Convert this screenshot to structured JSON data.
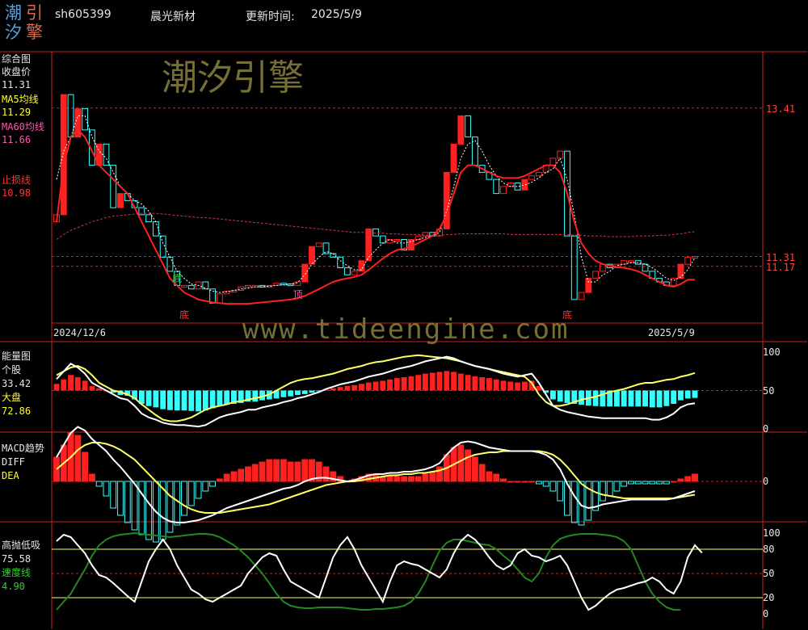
{
  "header": {
    "logo_chars": [
      "潮",
      "引",
      "汐",
      "擎"
    ],
    "code": "sh605399",
    "name": "晨光新材",
    "update_label": "更新时间:",
    "update_date": "2025/5/9"
  },
  "watermarks": {
    "brand": "潮汐引擎",
    "url": "www.tideengine.com"
  },
  "colors": {
    "frame": "#cc2222",
    "up": "#ff2020",
    "down": "#33ffff",
    "ma5": "#ffffff",
    "ma60": "#cc3355",
    "energy_market": "#ffff66",
    "energy_stock": "#ffffff",
    "speed": "#228822"
  },
  "panels": {
    "main": {
      "labels": [
        {
          "text": "综合图",
          "color": "w"
        },
        {
          "text": "收盘价",
          "color": "w"
        },
        {
          "text": "11.31",
          "color": "w"
        },
        {
          "text": "MA5均线",
          "color": "y"
        },
        {
          "text": "11.29",
          "color": "y"
        },
        {
          "text": "MA60均线",
          "color": "pk"
        },
        {
          "text": "11.66",
          "color": "pk"
        },
        {
          "text": "止损线",
          "color": "rd"
        },
        {
          "text": "10.98",
          "color": "rd"
        }
      ],
      "right_ticks": [
        "13.41",
        "11.31",
        "11.17"
      ],
      "markers": [
        {
          "text": "底",
          "color": "gr",
          "bar": 17
        },
        {
          "text": "底",
          "color": "rd",
          "bar": 18
        },
        {
          "text": "顶",
          "color": "pk",
          "bar": 34
        },
        {
          "text": "底",
          "color": "rd",
          "bar": 72
        }
      ],
      "start_date": "2024/12/6",
      "end_date": "2025/5/9"
    },
    "energy": {
      "labels": [
        {
          "text": "能量图",
          "color": "w"
        },
        {
          "text": "个股",
          "color": "w"
        },
        {
          "text": "33.42",
          "color": "w"
        },
        {
          "text": "大盘",
          "color": "y"
        },
        {
          "text": "72.86",
          "color": "y"
        }
      ],
      "right_ticks": [
        "100",
        "50",
        "0"
      ]
    },
    "macd": {
      "labels": [
        {
          "text": "MACD趋势",
          "color": "w"
        },
        {
          "text": "DIFF",
          "color": "w"
        },
        {
          "text": "DEA",
          "color": "y"
        }
      ],
      "right_ticks": [
        "0"
      ]
    },
    "tide": {
      "labels": [
        {
          "text": "高抛低吸",
          "color": "w"
        },
        {
          "text": "75.58",
          "color": "w"
        },
        {
          "text": "速度线",
          "color": "gr"
        },
        {
          "text": "4.90",
          "color": "gr"
        }
      ],
      "right_ticks": [
        "100",
        "80",
        "50",
        "20",
        "0"
      ]
    }
  },
  "chart_data": {
    "type": "candlestick",
    "price_axis_ticks": [
      13.41,
      11.31,
      11.17
    ],
    "close": [
      11.9,
      13.6,
      13.0,
      13.4,
      13.1,
      12.6,
      12.9,
      12.6,
      12.0,
      12.2,
      12.1,
      12.0,
      11.9,
      11.8,
      11.6,
      11.3,
      11.1,
      10.9,
      10.9,
      10.85,
      10.95,
      10.85,
      10.65,
      10.78,
      10.82,
      10.83,
      10.88,
      10.9,
      10.9,
      10.88,
      10.9,
      10.93,
      10.92,
      10.9,
      10.95,
      11.2,
      11.45,
      11.5,
      11.35,
      11.3,
      11.15,
      11.05,
      11.1,
      11.25,
      11.7,
      11.6,
      11.5,
      11.55,
      11.55,
      11.4,
      11.55,
      11.6,
      11.65,
      11.6,
      11.7,
      12.5,
      12.9,
      13.3,
      13.0,
      12.6,
      12.5,
      12.4,
      12.2,
      12.3,
      12.35,
      12.25,
      12.4,
      12.45,
      12.5,
      12.6,
      12.7,
      12.8,
      11.6,
      10.7,
      10.8,
      11.0,
      11.1,
      11.2,
      11.15,
      11.2,
      11.25,
      11.25,
      11.2,
      11.1,
      11.0,
      10.95,
      10.9,
      11.0,
      11.2,
      11.3,
      11.31
    ],
    "ma5": [
      12.4,
      12.8,
      13.0,
      13.3,
      13.3,
      13.0,
      12.8,
      12.7,
      12.5,
      12.3,
      12.2,
      12.1,
      12.05,
      11.95,
      11.8,
      11.5,
      11.3,
      11.1,
      11.0,
      10.92,
      10.9,
      10.86,
      10.82,
      10.8,
      10.81,
      10.83,
      10.85,
      10.86,
      10.88,
      10.88,
      10.89,
      10.9,
      10.91,
      10.92,
      10.94,
      11.05,
      11.2,
      11.3,
      11.38,
      11.35,
      11.25,
      11.18,
      11.12,
      11.12,
      11.3,
      11.4,
      11.5,
      11.55,
      11.5,
      11.5,
      11.52,
      11.55,
      11.58,
      11.6,
      11.65,
      11.95,
      12.3,
      12.7,
      12.9,
      12.95,
      12.8,
      12.6,
      12.45,
      12.35,
      12.3,
      12.3,
      12.32,
      12.36,
      12.42,
      12.5,
      12.55,
      12.7,
      12.4,
      11.9,
      11.3,
      10.95,
      10.95,
      11.05,
      11.1,
      11.18,
      11.2,
      11.22,
      11.22,
      11.2,
      11.15,
      11.08,
      11.0,
      10.97,
      11.02,
      11.12,
      11.29
    ],
    "ma60": [
      11.55,
      11.62,
      11.68,
      11.72,
      11.76,
      11.8,
      11.83,
      11.86,
      11.88,
      11.89,
      11.9,
      11.91,
      11.92,
      11.92,
      11.92,
      11.91,
      11.9,
      11.89,
      11.88,
      11.87,
      11.86,
      11.86,
      11.85,
      11.84,
      11.83,
      11.82,
      11.81,
      11.8,
      11.79,
      11.78,
      11.77,
      11.76,
      11.75,
      11.74,
      11.73,
      11.72,
      11.71,
      11.7,
      11.69,
      11.68,
      11.67,
      11.66,
      11.65,
      11.65,
      11.65,
      11.64,
      11.64,
      11.63,
      11.63,
      11.62,
      11.62,
      11.62,
      11.61,
      11.61,
      11.61,
      11.62,
      11.62,
      11.63,
      11.63,
      11.63,
      11.63,
      11.63,
      11.63,
      11.63,
      11.62,
      11.62,
      11.62,
      11.62,
      11.62,
      11.62,
      11.62,
      11.62,
      11.62,
      11.61,
      11.61,
      11.6,
      11.6,
      11.6,
      11.59,
      11.59,
      11.59,
      11.59,
      11.6,
      11.6,
      11.6,
      11.61,
      11.61,
      11.62,
      11.63,
      11.65,
      11.66
    ],
    "stop_line": [
      11.8,
      12.6,
      13.0,
      13.1,
      13.0,
      12.8,
      12.6,
      12.5,
      12.4,
      12.3,
      12.2,
      12.0,
      11.8,
      11.6,
      11.4,
      11.2,
      11.0,
      10.9,
      10.8,
      10.75,
      10.7,
      10.68,
      10.66,
      10.65,
      10.64,
      10.64,
      10.64,
      10.64,
      10.65,
      10.66,
      10.67,
      10.68,
      10.69,
      10.7,
      10.72,
      10.75,
      10.8,
      10.85,
      10.9,
      10.95,
      10.98,
      11.0,
      11.02,
      11.05,
      11.12,
      11.2,
      11.28,
      11.35,
      11.4,
      11.42,
      11.45,
      11.5,
      11.55,
      11.6,
      11.7,
      11.9,
      12.2,
      12.5,
      12.6,
      12.6,
      12.55,
      12.5,
      12.45,
      12.42,
      12.42,
      12.42,
      12.45,
      12.5,
      12.55,
      12.6,
      12.6,
      12.5,
      12.2,
      11.8,
      11.5,
      11.35,
      11.25,
      11.2,
      11.18,
      11.16,
      11.15,
      11.13,
      11.1,
      11.05,
      11.0,
      10.95,
      10.9,
      10.88,
      10.92,
      10.98,
      10.98
    ],
    "energy_stock": [
      65,
      75,
      85,
      80,
      72,
      60,
      55,
      50,
      45,
      40,
      38,
      30,
      20,
      15,
      12,
      8,
      6,
      5,
      5,
      4,
      3,
      5,
      10,
      15,
      18,
      20,
      22,
      25,
      25,
      28,
      30,
      32,
      35,
      37,
      40,
      42,
      45,
      48,
      52,
      55,
      58,
      60,
      62,
      65,
      68,
      70,
      72,
      75,
      78,
      80,
      82,
      85,
      88,
      90,
      92,
      94,
      92,
      88,
      85,
      82,
      80,
      78,
      75,
      72,
      70,
      68,
      70,
      72,
      60,
      45,
      30,
      25,
      22,
      20,
      18,
      16,
      15,
      14,
      14,
      14,
      14,
      14,
      14,
      14,
      12,
      12,
      15,
      20,
      28,
      32,
      33.42
    ],
    "energy_market": [
      70,
      75,
      80,
      82,
      78,
      70,
      60,
      55,
      50,
      48,
      45,
      40,
      32,
      25,
      18,
      12,
      10,
      10,
      12,
      15,
      20,
      25,
      28,
      30,
      32,
      35,
      36,
      38,
      40,
      42,
      45,
      50,
      55,
      60,
      63,
      65,
      66,
      68,
      70,
      72,
      75,
      78,
      80,
      82,
      85,
      87,
      88,
      90,
      92,
      94,
      95,
      96,
      95,
      94,
      93,
      92,
      90,
      88,
      85,
      82,
      80,
      78,
      76,
      74,
      72,
      70,
      68,
      60,
      45,
      35,
      30,
      30,
      32,
      35,
      38,
      40,
      42,
      45,
      48,
      50,
      52,
      55,
      58,
      60,
      60,
      62,
      64,
      65,
      68,
      70,
      72.86
    ],
    "diff": [
      0.2,
      0.3,
      0.4,
      0.45,
      0.42,
      0.35,
      0.3,
      0.25,
      0.18,
      0.12,
      0.05,
      -0.02,
      -0.1,
      -0.18,
      -0.25,
      -0.3,
      -0.33,
      -0.34,
      -0.34,
      -0.33,
      -0.32,
      -0.3,
      -0.28,
      -0.25,
      -0.22,
      -0.2,
      -0.18,
      -0.16,
      -0.14,
      -0.12,
      -0.1,
      -0.08,
      -0.06,
      -0.05,
      -0.03,
      0.0,
      0.02,
      0.03,
      0.03,
      0.02,
      0.01,
      0.0,
      0.01,
      0.03,
      0.05,
      0.06,
      0.06,
      0.07,
      0.07,
      0.08,
      0.08,
      0.09,
      0.1,
      0.12,
      0.15,
      0.22,
      0.28,
      0.32,
      0.33,
      0.32,
      0.3,
      0.28,
      0.27,
      0.26,
      0.25,
      0.25,
      0.25,
      0.25,
      0.24,
      0.22,
      0.18,
      0.1,
      -0.02,
      -0.12,
      -0.2,
      -0.22,
      -0.21,
      -0.19,
      -0.18,
      -0.17,
      -0.16,
      -0.15,
      -0.15,
      -0.15,
      -0.15,
      -0.15,
      -0.15,
      -0.14,
      -0.12,
      -0.1,
      -0.08
    ],
    "dea": [
      0.1,
      0.15,
      0.2,
      0.26,
      0.3,
      0.32,
      0.32,
      0.31,
      0.29,
      0.26,
      0.22,
      0.18,
      0.12,
      0.06,
      0.0,
      -0.06,
      -0.12,
      -0.16,
      -0.2,
      -0.23,
      -0.25,
      -0.26,
      -0.26,
      -0.26,
      -0.25,
      -0.24,
      -0.23,
      -0.22,
      -0.21,
      -0.2,
      -0.19,
      -0.17,
      -0.15,
      -0.13,
      -0.11,
      -0.09,
      -0.07,
      -0.05,
      -0.03,
      -0.02,
      -0.01,
      0.0,
      0.0,
      0.01,
      0.02,
      0.03,
      0.04,
      0.05,
      0.05,
      0.06,
      0.06,
      0.07,
      0.07,
      0.08,
      0.09,
      0.11,
      0.14,
      0.17,
      0.2,
      0.22,
      0.23,
      0.24,
      0.24,
      0.25,
      0.25,
      0.25,
      0.25,
      0.25,
      0.25,
      0.24,
      0.22,
      0.18,
      0.12,
      0.05,
      -0.02,
      -0.06,
      -0.09,
      -0.11,
      -0.12,
      -0.13,
      -0.14,
      -0.14,
      -0.14,
      -0.14,
      -0.14,
      -0.14,
      -0.14,
      -0.14,
      -0.13,
      -0.12,
      -0.11
    ],
    "tide_white": [
      90,
      98,
      95,
      85,
      75,
      60,
      48,
      45,
      38,
      30,
      22,
      15,
      40,
      65,
      80,
      92,
      80,
      60,
      45,
      30,
      25,
      18,
      15,
      20,
      25,
      30,
      35,
      50,
      60,
      70,
      75,
      72,
      55,
      40,
      35,
      30,
      25,
      20,
      45,
      70,
      85,
      95,
      80,
      60,
      45,
      30,
      15,
      40,
      60,
      65,
      62,
      60,
      55,
      50,
      45,
      55,
      75,
      90,
      98,
      92,
      82,
      70,
      60,
      55,
      60,
      75,
      80,
      72,
      70,
      65,
      68,
      72,
      60,
      40,
      20,
      5,
      10,
      18,
      25,
      30,
      32,
      35,
      38,
      40,
      45,
      40,
      30,
      25,
      40,
      70,
      85,
      75.58
    ],
    "tide_speed": [
      5,
      15,
      25,
      40,
      55,
      72,
      85,
      92,
      96,
      98,
      99,
      100,
      99,
      98,
      97,
      96,
      95,
      96,
      97,
      98,
      99,
      99,
      98,
      95,
      90,
      85,
      78,
      70,
      60,
      50,
      38,
      25,
      15,
      10,
      8,
      7,
      7,
      8,
      8,
      8,
      8,
      7,
      6,
      5,
      5,
      6,
      6,
      7,
      8,
      10,
      15,
      25,
      40,
      60,
      78,
      88,
      92,
      92,
      90,
      88,
      86,
      85,
      80,
      72,
      65,
      55,
      45,
      40,
      50,
      70,
      85,
      93,
      96,
      98,
      99,
      99,
      99,
      98,
      97,
      95,
      90,
      80,
      60,
      40,
      25,
      15,
      8,
      5,
      4.9
    ]
  }
}
